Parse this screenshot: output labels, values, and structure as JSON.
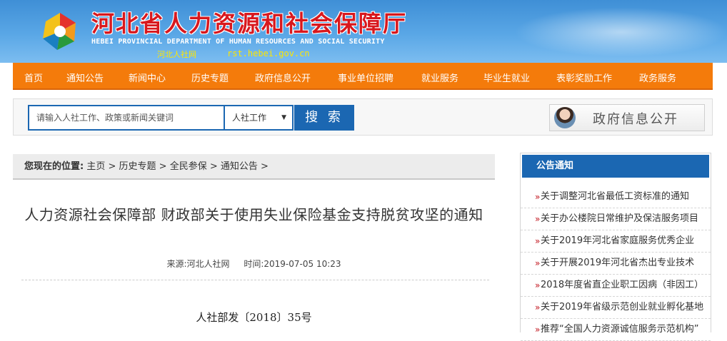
{
  "header": {
    "title": "河北省人力资源和社会保障厅",
    "subtitle": "HEBEI PROVINCIAL DEPARTMENT OF HUMAN RESOURCES AND SOCIAL SECURITY",
    "site_name": "河北人社网",
    "site_url": "rst.hebei.gov.cn"
  },
  "nav": {
    "items": [
      "首页",
      "通知公告",
      "新闻中心",
      "历史专题",
      "政府信息公开",
      "事业单位招聘",
      "就业服务",
      "毕业生就业",
      "表彰奖励工作",
      "政务服务"
    ]
  },
  "search": {
    "placeholder": "请输入人社工作、政策或新闻关键词",
    "category": "人社工作",
    "button": "搜 索",
    "gov_open": "政府信息公开"
  },
  "breadcrumb": {
    "prefix": "您现在的位置:",
    "items": [
      "主页",
      "历史专题",
      "全民参保",
      "通知公告"
    ],
    "sep": " > "
  },
  "article": {
    "title": "人力资源社会保障部 财政部关于使用失业保险基金支持脱贫攻坚的通知",
    "source": "来源:河北人社网",
    "time": "时间:2019-07-05 10:23",
    "doc_no": "人社部发〔2018〕35号"
  },
  "notice": {
    "heading": "公告通知",
    "items": [
      "关于调整河北省最低工资标准的通知",
      "关于办公楼院日常维护及保洁服务项目",
      "关于2019年河北省家庭服务优秀企业",
      "关于开展2019年河北省杰出专业技术",
      "2018年度省直企业职工因病（非因工）",
      "关于2019年省级示范创业就业孵化基地",
      "推荐“全国人力资源诚信服务示范机构”"
    ]
  },
  "colors": {
    "nav_bg": "#f47b0b",
    "brand_blue": "#1b67b2",
    "title_red": "#d8181e"
  }
}
